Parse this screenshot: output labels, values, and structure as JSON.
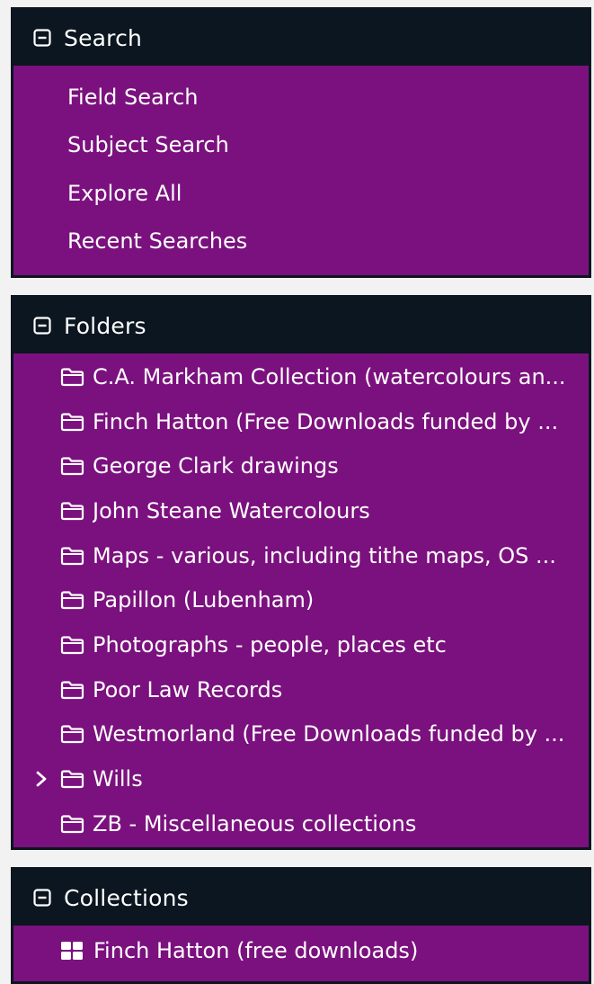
{
  "search": {
    "title": "Search",
    "items": [
      {
        "label": "Field Search"
      },
      {
        "label": "Subject Search"
      },
      {
        "label": "Explore All"
      },
      {
        "label": "Recent Searches"
      }
    ]
  },
  "folders": {
    "title": "Folders",
    "items": [
      {
        "label": "C.A. Markham Collection (watercolours an..."
      },
      {
        "label": "Finch Hatton (Free Downloads funded by ..."
      },
      {
        "label": "George Clark drawings"
      },
      {
        "label": "John Steane Watercolours"
      },
      {
        "label": "Maps - various, including tithe maps, OS ..."
      },
      {
        "label": "Papillon (Lubenham)"
      },
      {
        "label": "Photographs - people, places etc"
      },
      {
        "label": "Poor Law Records"
      },
      {
        "label": "Westmorland (Free Downloads funded by ..."
      },
      {
        "label": "Wills",
        "expandable": true
      },
      {
        "label": "ZB - Miscellaneous collections"
      }
    ]
  },
  "collections": {
    "title": "Collections",
    "items": [
      {
        "label": "Finch Hatton (free downloads)"
      }
    ]
  },
  "colors": {
    "panel_background": "#7b117e",
    "header_background": "#0b1620",
    "text": "#ffffff"
  },
  "icons": {
    "collapse": "minus-square-icon",
    "folder": "folder-icon",
    "expand": "chevron-right-icon",
    "collection": "grid-icon"
  }
}
